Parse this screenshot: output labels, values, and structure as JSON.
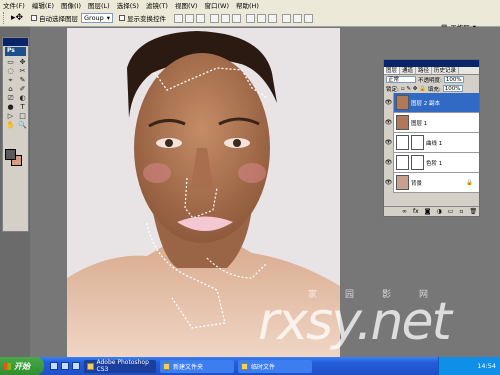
{
  "menu": [
    "文件(F)",
    "编辑(E)",
    "图像(I)",
    "图层(L)",
    "选择(S)",
    "滤镜(T)",
    "视图(V)",
    "窗口(W)",
    "帮助(H)"
  ],
  "options": {
    "auto_select_label": "自动选择图层",
    "group_value": "Group",
    "transform_label": "显示变换控件",
    "workspace_label": "工作区"
  },
  "toolbox": {
    "ps_label": "Ps",
    "tools": [
      "▭",
      "✥",
      "◌",
      "✂",
      "⌖",
      "✎",
      "⌂",
      "✐",
      "⎚",
      "◐",
      "●",
      "T",
      "▷",
      "□",
      "✋",
      "🔍"
    ]
  },
  "colors": {
    "foreground": "#5a5a5a",
    "background": "#d79a82"
  },
  "layers_panel": {
    "tabs": [
      "图层",
      "通道",
      "路径",
      "历史记录"
    ],
    "blend_mode": "正常",
    "opacity_label": "不透明度:",
    "opacity_value": "100%",
    "lock_label": "锁定:",
    "fill_label": "填充:",
    "fill_value": "100%",
    "layers": [
      {
        "name": "图层 2 副本",
        "selected": true,
        "thumb": "#b07a5a"
      },
      {
        "name": "图层 1",
        "selected": false,
        "thumb": "#b07a5a"
      },
      {
        "name": "曲线 1",
        "selected": false,
        "thumb": "#ffffff"
      },
      {
        "name": "色阶 1",
        "selected": false,
        "thumb": "#ffffff"
      },
      {
        "name": "背景",
        "selected": false,
        "thumb": "#c8a090"
      }
    ],
    "footer_icons": [
      "∞",
      "fx",
      "◙",
      "◑",
      "▭",
      "▫",
      "🗑"
    ]
  },
  "watermark": {
    "text": "rxsy.net",
    "chars": [
      "家",
      "园",
      "影",
      "网"
    ]
  },
  "taskbar": {
    "start_label": "开始",
    "tasks": [
      "Adobe Photoshop CS3",
      "新建文件夹",
      "临时文件"
    ],
    "clock": "14:54"
  }
}
